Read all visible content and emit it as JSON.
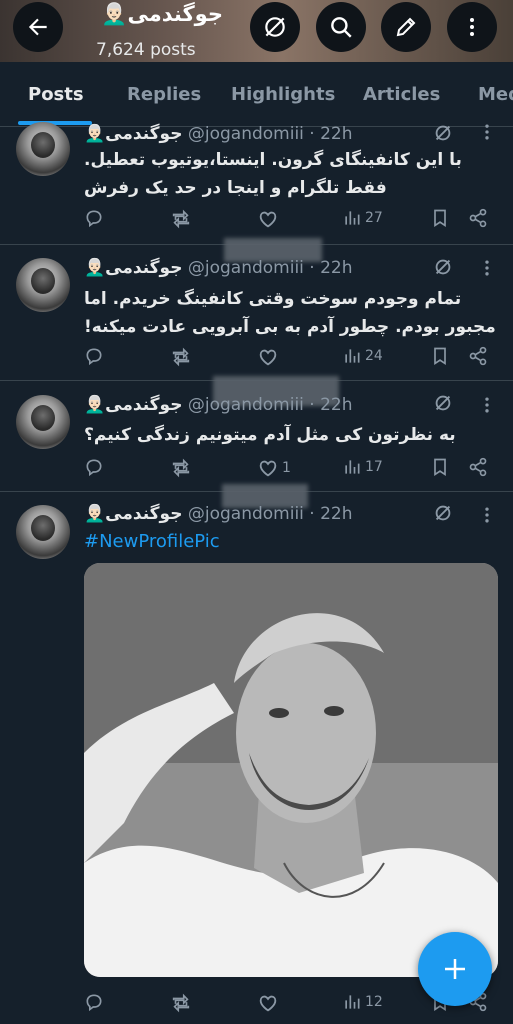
{
  "header": {
    "title": "جوگندمی👨🏻‍🦳",
    "post_count": "7,624 posts"
  },
  "tabs": [
    {
      "label": "Posts",
      "active": true
    },
    {
      "label": "Replies"
    },
    {
      "label": "Highlights"
    },
    {
      "label": "Articles"
    },
    {
      "label": "Med"
    }
  ],
  "tweets": [
    {
      "name": "👨🏻‍🦳جوگندمی",
      "handle": "@jogandomiii · 22h",
      "text": "با این کانفینگای گرون. اینستا،یوتیوب تعطیل. فقط تلگرام و اینجا در حد یک رفرش",
      "likes": "",
      "views": "27"
    },
    {
      "name": "👨🏻‍🦳جوگندمی",
      "handle": "@jogandomiii · 22h",
      "text": "تمام وجودم سوخت وقتی کانفینگ خریدم. اما مجبور بودم. چطور آدم به بی آبرویی عادت میکنه!",
      "likes": "",
      "views": "24"
    },
    {
      "name": "👨🏻‍🦳جوگندمی",
      "handle": "@jogandomiii · 22h",
      "text": "به نظرتون کی مثل آدم میتونیم زندگی کنیم؟",
      "likes": "1",
      "views": "17"
    },
    {
      "name": "👨🏻‍🦳جوگندمی",
      "handle": "@jogandomiii · 22h",
      "hashtag": "#NewProfilePic",
      "likes": "",
      "views": "12"
    }
  ],
  "colors": {
    "background": "#15202b",
    "accent": "#1d9bf0",
    "muted": "#8b98a5",
    "divider": "#38444d"
  },
  "icons": {
    "back": "arrow-left-icon",
    "grok": "grok-icon",
    "search": "search-icon",
    "compose": "pencil-icon",
    "more": "more-vertical-icon",
    "fab": "plus-icon"
  }
}
